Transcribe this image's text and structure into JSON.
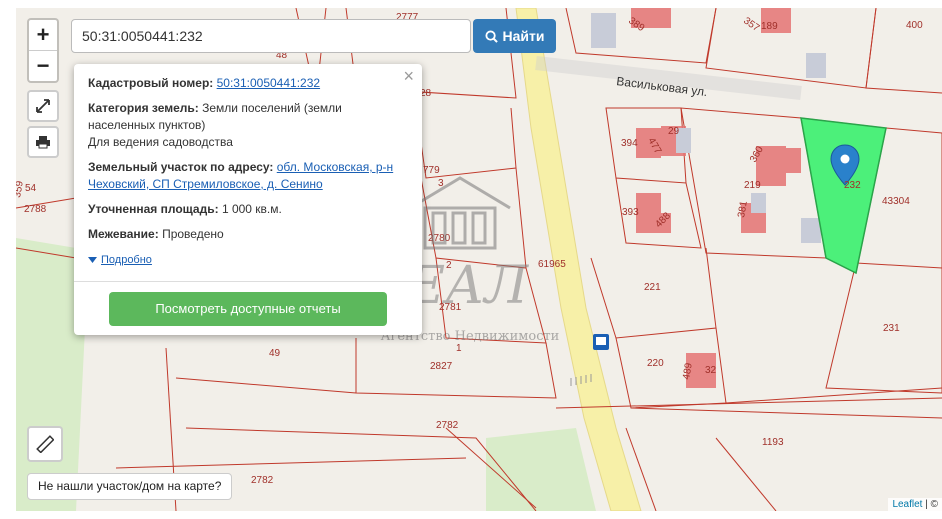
{
  "search": {
    "value": "50:31:0050441:232",
    "button_label": "Найти"
  },
  "zoom": {
    "in": "+",
    "out": "−"
  },
  "popup": {
    "cadastral_label": "Кадастровый номер:",
    "cadastral_value": "50:31:0050441:232",
    "category_label": "Категория земель:",
    "category_value": "Земли поселений (земли населенных пунктов)",
    "category_use": "Для ведения садоводства",
    "address_label": "Земельный участок по адресу:",
    "address_value": "обл. Московская, р-н Чеховский, СП Стремиловское, д. Сенино",
    "area_label": "Уточненная площадь:",
    "area_value": "1 000 кв.м.",
    "survey_label": "Межевание:",
    "survey_value": "Проведено",
    "more_label": "Подробно",
    "report_button": "Посмотреть доступные отчеты",
    "close": "×"
  },
  "map": {
    "street": "Васильковая ул.",
    "plots": [
      "2777",
      "389",
      "357",
      "189",
      "400",
      "48",
      "28",
      "394",
      "477",
      "29",
      "360",
      "219",
      "232",
      "43304",
      "3",
      "779",
      "393",
      "488",
      "381",
      "2780",
      "2",
      "61965",
      "221",
      "2781",
      "231",
      "49",
      "2827",
      "1",
      "220",
      "489",
      "32",
      "2782",
      "1193",
      "2782",
      "54",
      "359",
      "2788"
    ]
  },
  "watermark": {
    "logo": "РЕАЛ",
    "tagline": "Агентство Недвижимости"
  },
  "not_found": "Не нашли участок/дом на карте?",
  "attribution": {
    "leaflet": "Leaflet",
    "rest": "| ©"
  },
  "colors": {
    "selected_plot": "#4cf07a",
    "plot_border": "#c0392b",
    "marker": "#2a81cb",
    "find_button": "#337ab7",
    "report_button": "#5cb85c"
  }
}
